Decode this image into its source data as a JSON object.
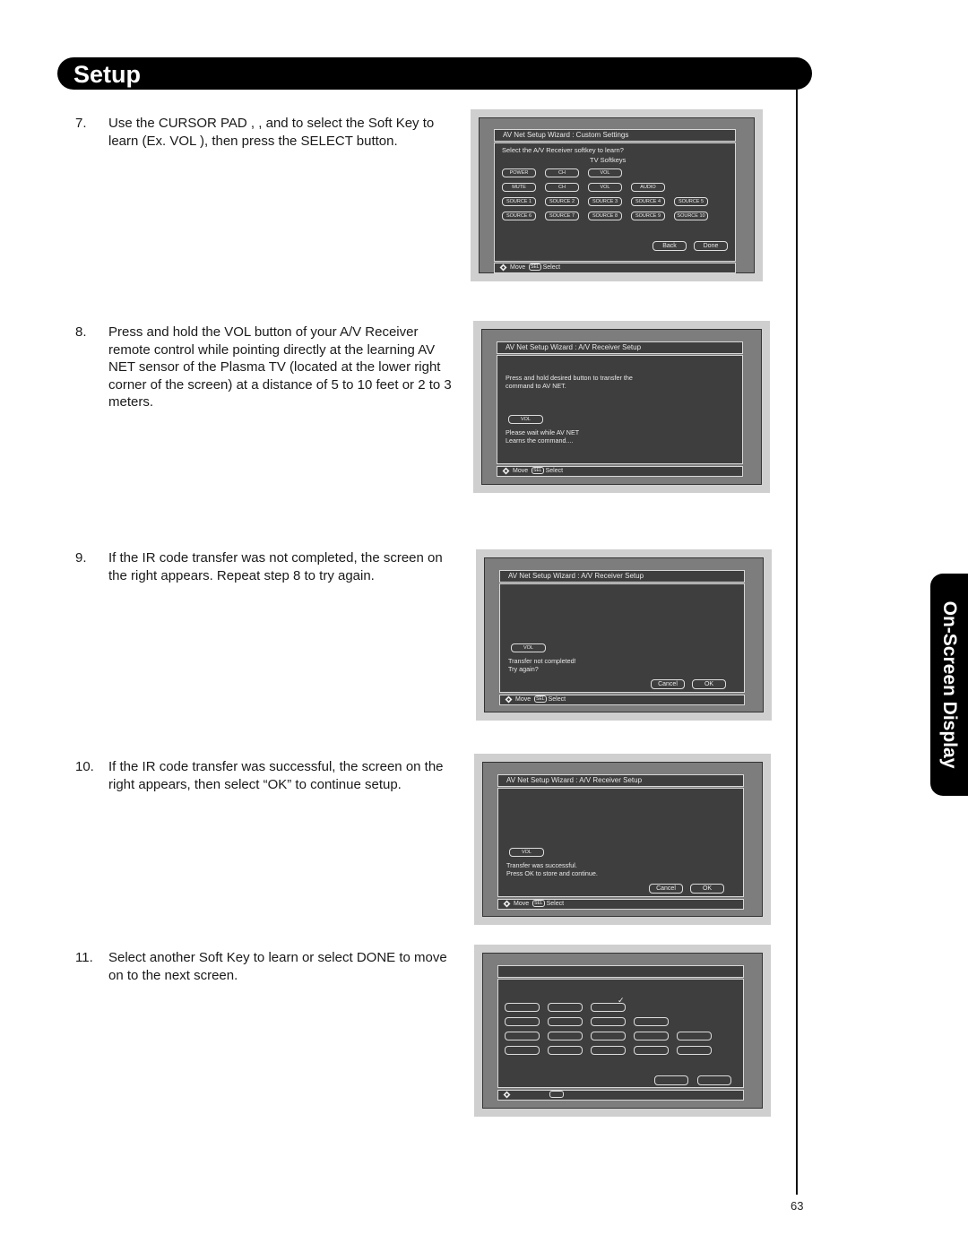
{
  "header": {
    "title": "Setup"
  },
  "side_tab": {
    "label": "On-Screen Display"
  },
  "page_number": "63",
  "steps": [
    {
      "num": "7.",
      "text": "Use the CURSOR PAD  ,  ,  and  to select the Soft Key to learn (Ex. VOL  ), then press the SELECT button."
    },
    {
      "num": "8.",
      "text": "Press and hold the VOL  button of your A/V Receiver remote control while pointing directly at the learning AV NET sensor of the Plasma TV (located at the lower right corner of the screen) at a distance of 5 to 10 feet or 2 to 3 meters."
    },
    {
      "num": "9.",
      "text": "If the IR code transfer was not completed, the screen on the right appears.  Repeat step 8 to try again."
    },
    {
      "num": "10.",
      "text": "If the IR code transfer was successful, the screen on the right appears, then select “OK” to continue setup."
    },
    {
      "num": "11.",
      "text": "Select another Soft Key to learn or select DONE to move on to the next screen."
    }
  ],
  "footer_legend": {
    "move": "Move",
    "sel_badge": "SEL",
    "select": "Select"
  },
  "screens": [
    {
      "title": "AV Net Setup Wizard : Custom Settings",
      "prompt": "Select the A/V Receiver softkey to learn?",
      "subtitle": "TV Softkeys",
      "keys": [
        [
          "POWER",
          "CH",
          "VOL"
        ],
        [
          "MUTE",
          "CH",
          "VOL",
          "AUDIO"
        ],
        [
          "SOURCE 1",
          "SOURCE 2",
          "SOURCE 3",
          "SOURCE 4",
          "SOURCE 5"
        ],
        [
          "SOURCE 6",
          "SOURCE 7",
          "SOURCE 8",
          "SOURCE 9",
          "SOURCE 10"
        ]
      ],
      "buttons": [
        "Back",
        "Done"
      ]
    },
    {
      "title": "AV Net Setup Wizard : A/V Receiver Setup",
      "instruction": [
        "Press and hold desired button to transfer the",
        "command to AV NET."
      ],
      "key": "VOL",
      "message": [
        "Please wait while AV NET",
        "Learns the command...."
      ]
    },
    {
      "title": "AV Net Setup Wizard : A/V Receiver Setup",
      "key": "VOL",
      "message": [
        "Transfer not completed!",
        "Try again?"
      ],
      "buttons": [
        "Cancel",
        "OK"
      ]
    },
    {
      "title": "AV Net Setup Wizard : A/V Receiver Setup",
      "key": "VOL",
      "message": [
        "Transfer was successful.",
        "Press OK to store and continue."
      ],
      "buttons": [
        "Cancel",
        "OK"
      ]
    },
    {
      "checkmark": "✓"
    }
  ]
}
